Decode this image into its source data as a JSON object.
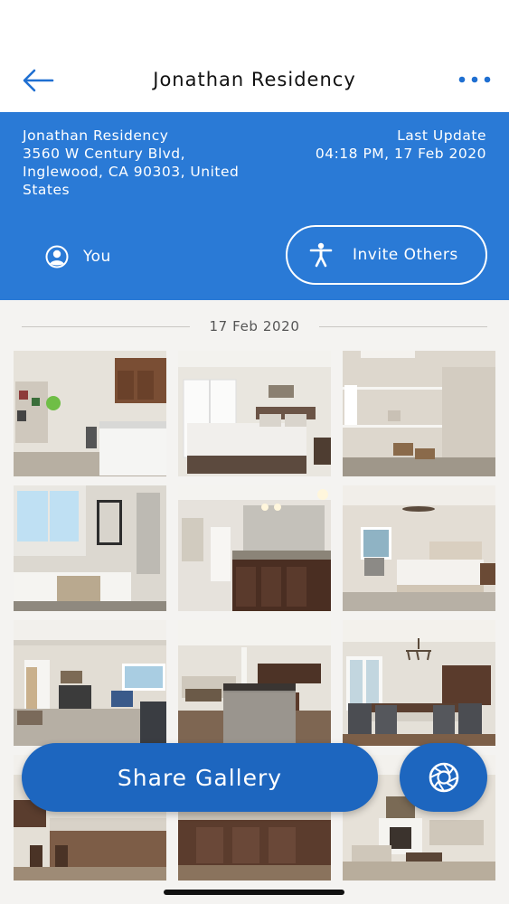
{
  "header": {
    "title": "Jonathan Residency",
    "back_icon": "arrow-left-icon",
    "more_icon": "more-horizontal-icon"
  },
  "info": {
    "address_lines": [
      "Jonathan Residency",
      "3560 W Century Blvd,",
      "Inglewood, CA 90303, United",
      "States"
    ],
    "last_update_label": "Last Update",
    "last_update_value": "04:18 PM, 17 Feb 2020"
  },
  "actions": {
    "you_label": "You",
    "invite_label": "Invite Others"
  },
  "gallery": {
    "date": "17 Feb 2020",
    "photos": [
      {
        "name": "laundry-room"
      },
      {
        "name": "bedroom"
      },
      {
        "name": "walk-in-closet"
      },
      {
        "name": "bathroom-tub"
      },
      {
        "name": "bathroom-vanity"
      },
      {
        "name": "master-bedroom"
      },
      {
        "name": "living-room"
      },
      {
        "name": "kitchen-island"
      },
      {
        "name": "dining-room"
      },
      {
        "name": "kitchen-bar"
      },
      {
        "name": "kitchen-counter"
      },
      {
        "name": "kitchen-stools"
      },
      {
        "name": "family-room"
      }
    ]
  },
  "footer": {
    "share_label": "Share Gallery",
    "camera_icon": "camera-shutter-icon"
  },
  "colors": {
    "brand_blue": "#2a7ad6",
    "button_blue": "#1d66bf"
  }
}
